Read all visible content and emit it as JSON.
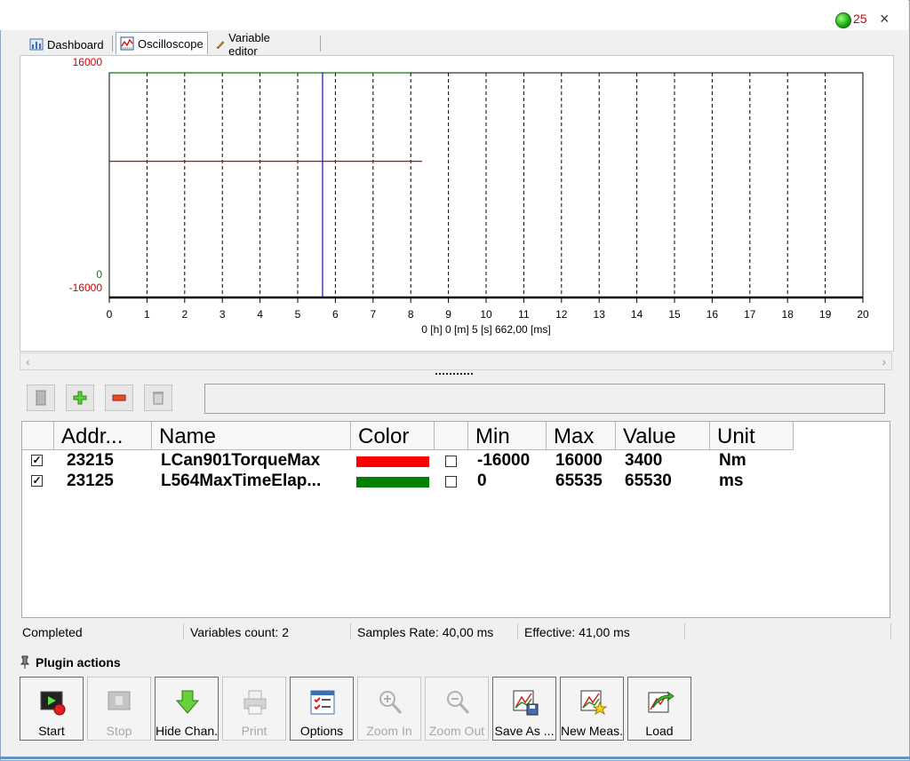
{
  "header": {
    "status_count": "25",
    "close_label": "×"
  },
  "tabs": [
    {
      "label": "Dashboard",
      "icon": "dashboard-icon"
    },
    {
      "label": "Oscilloscope",
      "icon": "oscilloscope-icon",
      "active": true
    },
    {
      "label": "Variable editor",
      "icon": "variable-editor-icon"
    }
  ],
  "chart_data": {
    "type": "line",
    "xlim": [
      0,
      20
    ],
    "x_ticks": [
      "0",
      "1",
      "2",
      "3",
      "4",
      "5",
      "6",
      "7",
      "8",
      "9",
      "10",
      "11",
      "12",
      "13",
      "14",
      "15",
      "16",
      "17",
      "18",
      "19",
      "20"
    ],
    "x_caption": "0 [h] 0 [m] 5 [s] 662,00 [ms]",
    "y_labels": {
      "red_top": "16000",
      "red_bottom": "-16000",
      "green_bottom": "0"
    },
    "cursor_x": 5.66,
    "grid": "dashed vertical",
    "series": [
      {
        "color": "#d00000",
        "x": [
          0,
          8.3
        ],
        "y": [
          3400,
          3400
        ],
        "ylim": [
          -16000,
          16000
        ]
      },
      {
        "color": "#008000",
        "x": [
          0,
          8.0
        ],
        "y": [
          65530,
          65530
        ],
        "ylim": [
          0,
          65535
        ]
      }
    ]
  },
  "grid": {
    "headers": [
      "Addr...",
      "Name",
      "Color",
      "",
      "Min",
      "Max",
      "Value",
      "Unit"
    ],
    "rows": [
      {
        "checked": "✓",
        "addr": "23215",
        "name": "LCan901TorqueMax",
        "color": "#ff0000",
        "min": "-16000",
        "max": "16000",
        "value": "3400",
        "unit": "Nm"
      },
      {
        "checked": "✓",
        "addr": "23125",
        "name": "L564MaxTimeElap...",
        "color": "#008000",
        "min": "0",
        "max": "65535",
        "value": "65530",
        "unit": "ms"
      }
    ]
  },
  "statusbar": {
    "state": "Completed",
    "variables": "Variables count: 2",
    "samples": "Samples Rate: 40,00 ms",
    "effective": "Effective: 41,00 ms"
  },
  "plugin": {
    "title": "Plugin actions",
    "buttons": [
      {
        "label": "Start",
        "enabled": true
      },
      {
        "label": "Stop",
        "enabled": false
      },
      {
        "label": "Hide Chan.",
        "enabled": true
      },
      {
        "label": "Print",
        "enabled": false
      },
      {
        "label": "Options",
        "enabled": true
      },
      {
        "label": "Zoom In",
        "enabled": false
      },
      {
        "label": "Zoom Out",
        "enabled": false
      },
      {
        "label": "Save As ...",
        "enabled": true
      },
      {
        "label": "New Meas...",
        "enabled": true
      },
      {
        "label": "Load",
        "enabled": true
      }
    ]
  }
}
